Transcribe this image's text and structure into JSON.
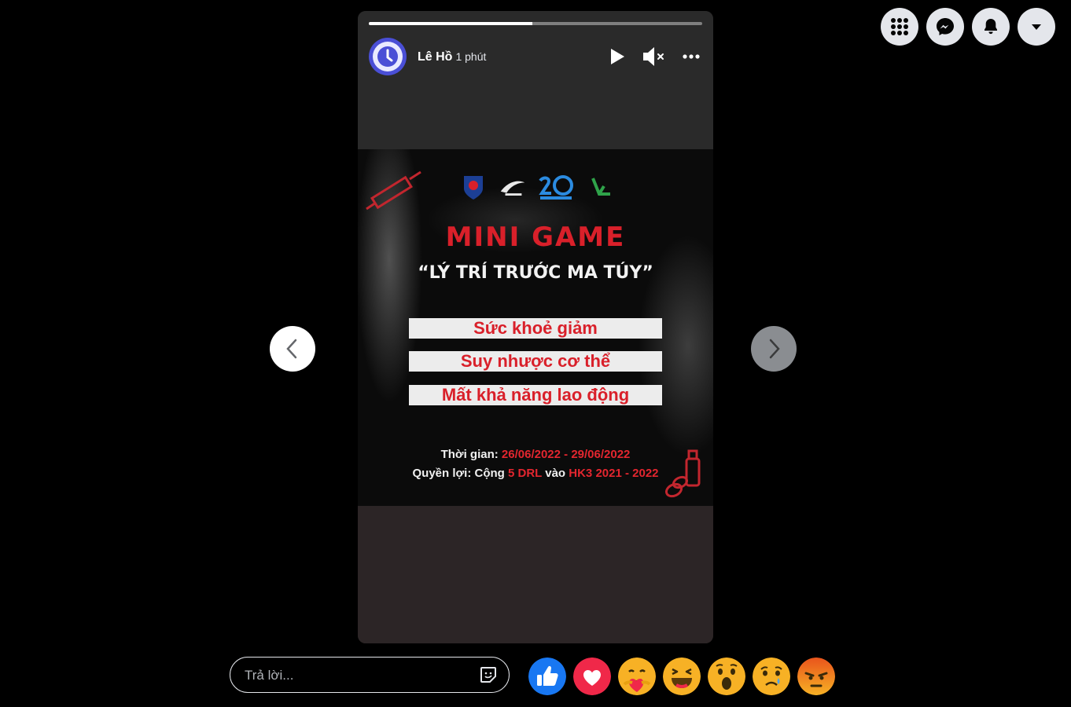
{
  "story": {
    "author": "Lê Hồ",
    "time": "1 phút",
    "progress": 0.49
  },
  "poster": {
    "title": "MINI GAME",
    "subtitle": "“LÝ TRÍ TRƯỚC MA TÚY”",
    "banners": [
      "Sức khoẻ giảm",
      "Suy nhược cơ thể",
      "Mất khả năng lao động"
    ],
    "time_label": "Thời gian:",
    "time_value": "26/06/2022 - 29/06/2022",
    "benefit_label": "Quyền lợi: Cộng",
    "benefit_value": "5 DRL",
    "benefit_mid": "vào",
    "benefit_term": "HK3 2021 - 2022"
  },
  "reply": {
    "placeholder": "Trả lời..."
  },
  "reactions": [
    "like-reaction",
    "love-reaction",
    "care-reaction",
    "haha-reaction",
    "wow-reaction",
    "sad-reaction",
    "angry-reaction"
  ],
  "colors": {
    "accent_red": "#d9202a",
    "like_blue": "#1877f2"
  }
}
